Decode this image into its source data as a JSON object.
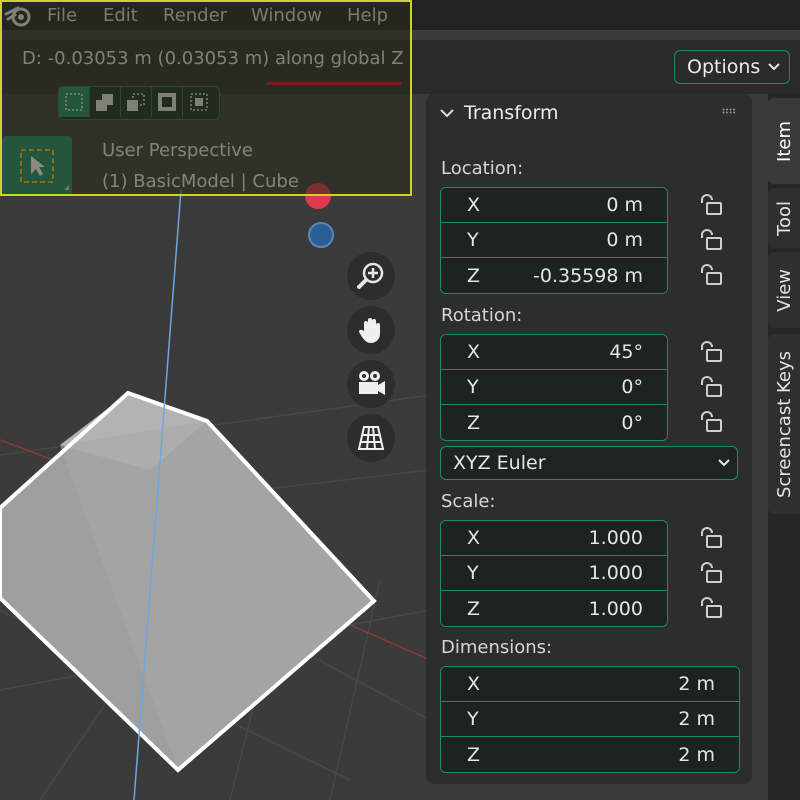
{
  "menu": {
    "file": "File",
    "edit": "Edit",
    "render": "Render",
    "window": "Window",
    "help": "Help"
  },
  "status": {
    "transform_text": "D: -0.03053 m (0.03053 m) along global Z"
  },
  "viewport": {
    "title": "User Perspective",
    "subtitle": "(1) BasicModel | Cube"
  },
  "header": {
    "options_label": "Options"
  },
  "panel": {
    "title": "Transform",
    "location": {
      "label": "Location:",
      "x_label": "X",
      "x": "0 m",
      "y_label": "Y",
      "y": "0 m",
      "z_label": "Z",
      "z": "-0.35598 m"
    },
    "rotation": {
      "label": "Rotation:",
      "x_label": "X",
      "x": "45°",
      "y_label": "Y",
      "y": "0°",
      "z_label": "Z",
      "z": "0°"
    },
    "rotation_mode": "XYZ Euler",
    "scale": {
      "label": "Scale:",
      "x_label": "X",
      "x": "1.000",
      "y_label": "Y",
      "y": "1.000",
      "z_label": "Z",
      "z": "1.000"
    },
    "dimensions": {
      "label": "Dimensions:",
      "x_label": "X",
      "x": "2 m",
      "y_label": "Y",
      "y": "2 m",
      "z_label": "Z",
      "z": "2 m"
    }
  },
  "sidebar_tabs": {
    "item": "Item",
    "tool": "Tool",
    "view": "View",
    "screencast": "Screencast Keys"
  },
  "colors": {
    "accent": "#1f8a66",
    "highlight": "#cfd12f",
    "underline": "#e01414"
  }
}
